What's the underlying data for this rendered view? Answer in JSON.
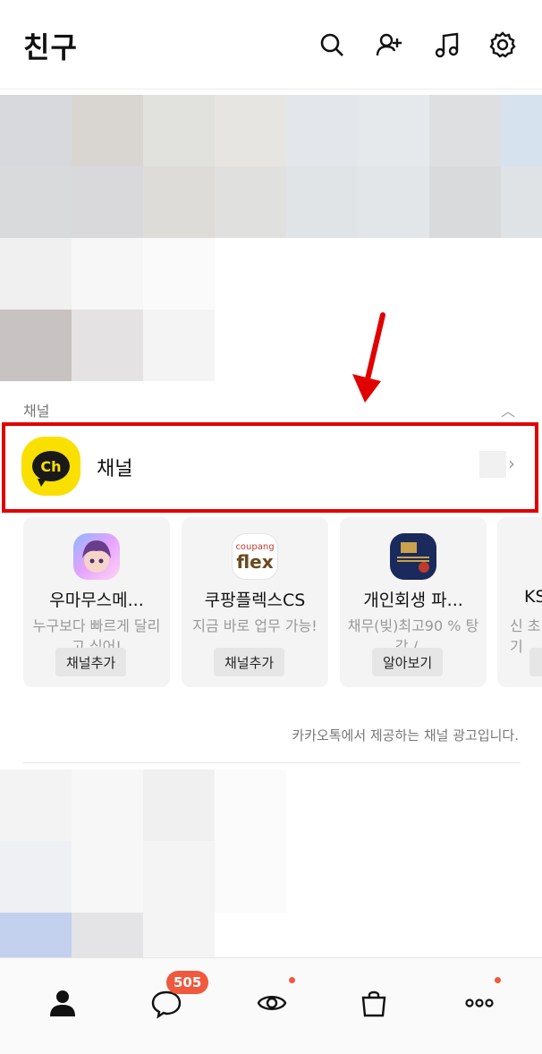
{
  "header": {
    "title": "친구",
    "icons": [
      "search-icon",
      "add-friend-icon",
      "music-icon",
      "settings-icon"
    ]
  },
  "channel_section": {
    "label": "채널",
    "collapse_glyph": "︿",
    "row_label": "채널",
    "logo_text": "Ch",
    "chevron": "›"
  },
  "ad_cards": [
    {
      "title": "우마무스메...",
      "desc": "누구보다 빠르게 달리고 싶어!",
      "button": "채널추가"
    },
    {
      "title": "쿠팡플렉스CS",
      "desc": "지금 바로 업무 가능!",
      "button": "채널추가",
      "logo_small": "coupang",
      "logo_big": "flex"
    },
    {
      "title": "개인회생 파...",
      "desc": "채무(빚)최고90 % 탕감 /...",
      "button": "알아보기"
    },
    {
      "title": "KS",
      "desc": "신 초기",
      "button": ""
    }
  ],
  "ad_note": "카카오톡에서 제공하는 채널 광고입니다.",
  "tabbar": {
    "unread_count": "505",
    "tabs": [
      "friends-tab",
      "chats-tab",
      "view-tab",
      "shopping-tab",
      "more-tab"
    ]
  },
  "colors": {
    "kakao_yellow": "#f9e000",
    "highlight_red": "#e00000",
    "badge_orange": "#f0593e"
  }
}
